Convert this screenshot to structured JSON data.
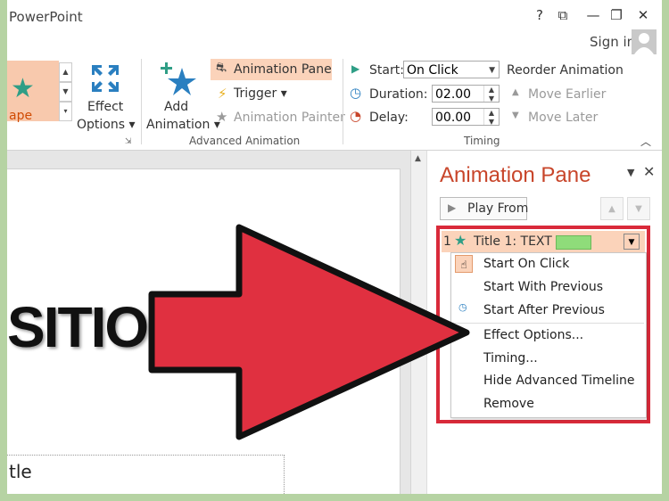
{
  "window": {
    "app_title": "PowerPoint",
    "help_label": "?",
    "restore_ribbon_glyph": "⧉",
    "minimize_glyph": "—",
    "maximize_glyph": "❐",
    "close_glyph": "✕",
    "sign_in": "Sign in"
  },
  "ribbon": {
    "shape_label": "ape",
    "effect_options": [
      "Effect",
      "Options ▾"
    ],
    "add_animation": [
      "Add",
      "Animation ▾"
    ],
    "animation_pane": "Animation Pane",
    "trigger": "Trigger ▾",
    "animation_painter": "Animation Painter",
    "group_advanced": "Advanced Animation",
    "start_label": "Start:",
    "start_value": "On Click",
    "duration_label": "Duration:",
    "duration_value": "02.00",
    "delay_label": "Delay:",
    "delay_value": "00.00",
    "reorder_title": "Reorder Animation",
    "move_earlier": "Move Earlier",
    "move_later": "Move Later",
    "group_timing": "Timing"
  },
  "slide": {
    "title_fragment": "SITION",
    "subtitle_fragment": "tle"
  },
  "pane": {
    "title": "Animation Pane",
    "play_from": "Play From",
    "item_number": "1",
    "item_label": "Title 1: TEXT ...",
    "menu": [
      "Start On Click",
      "Start With Previous",
      "Start After Previous",
      "Effect Options...",
      "Timing...",
      "Hide Advanced Timeline",
      "Remove"
    ]
  },
  "colors": {
    "accent": "#c8452a",
    "highlight": "#fbd3ba",
    "arrow": "#e03040",
    "star": "#2f9e86",
    "timeline_bar": "#8fdc7a"
  }
}
